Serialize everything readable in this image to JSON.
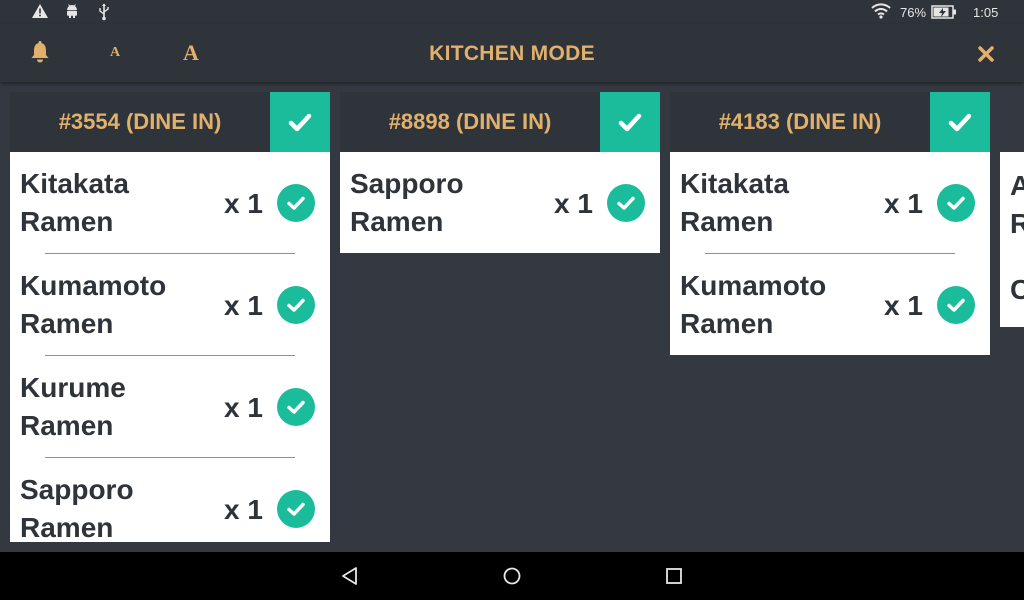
{
  "status_bar": {
    "battery": "76%",
    "time": "1:05",
    "icons": [
      "warning-icon",
      "android-icon",
      "usb-icon",
      "wifi-icon",
      "battery-charging-icon"
    ]
  },
  "app_bar": {
    "title": "KITCHEN MODE",
    "font_small_label": "A",
    "font_large_label": "A",
    "icons": [
      "bell-icon",
      "close-icon"
    ]
  },
  "orders": [
    {
      "title": "#3554 (DINE IN)",
      "items": [
        {
          "name": "Kitakata Ramen",
          "qty": "x 1"
        },
        {
          "name": "Kumamoto Ramen",
          "qty": "x 1"
        },
        {
          "name": "Kurume Ramen",
          "qty": "x 1"
        },
        {
          "name": "Sapporo Ramen",
          "qty": "x 1"
        }
      ]
    },
    {
      "title": "#8898 (DINE IN)",
      "items": [
        {
          "name": "Sapporo Ramen",
          "qty": "x 1"
        }
      ]
    },
    {
      "title": "#4183 (DINE IN)",
      "items": [
        {
          "name": "Kitakata Ramen",
          "qty": "x 1"
        },
        {
          "name": "Kumamoto Ramen",
          "qty": "x 1"
        }
      ]
    }
  ],
  "partial_card": {
    "line1": "A",
    "line2": "R",
    "line3": "C"
  },
  "colors": {
    "accent": "#e2b06d",
    "check": "#1abc9c",
    "background": "#343840",
    "header": "#2f333a",
    "text_dark": "#2f333a"
  }
}
